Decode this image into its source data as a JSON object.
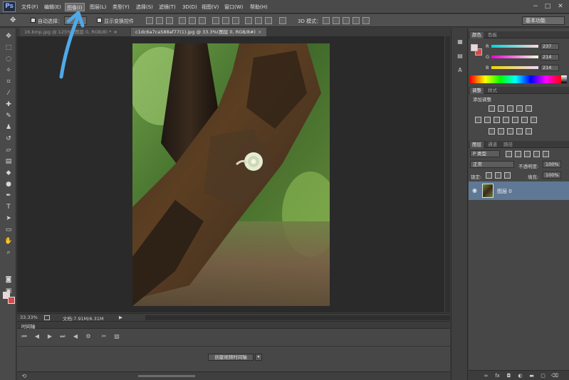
{
  "app": {
    "logo": "Ps",
    "accent_color": "#4f8fd9"
  },
  "menu": {
    "items": [
      "文件(F)",
      "编辑(E)",
      "图像(I)",
      "图层(L)",
      "类型(Y)",
      "选择(S)",
      "滤镜(T)",
      "3D(D)",
      "视图(V)",
      "窗口(W)",
      "帮助(H)"
    ],
    "active_index": 2
  },
  "window_controls": {
    "minimize": "−",
    "maximize": "□",
    "close": "✕"
  },
  "options": {
    "auto_select_label": "自动选择：",
    "transform_label": "显示变换控件",
    "mode_3d_label": "3D 模式：",
    "workspace": "基本功能"
  },
  "doc_tabs": [
    {
      "title": "16.bmp.jpg @ 125% (图层 0, RGB/8) *",
      "close": "×",
      "active": false
    },
    {
      "title": "c1dc6a7ca588af77(1).jpg @ 33.3%(图层 0, RGB/8#)",
      "close": "×",
      "active": true
    }
  ],
  "status": {
    "zoom": "33.33%",
    "doc_label": "文档:7.91M/6.31M"
  },
  "timeline": {
    "title": "时间轴",
    "create_button": "创建视频时间轴",
    "dropdown": "▾"
  },
  "panels": {
    "color": {
      "tabs": [
        "颜色",
        "色板"
      ],
      "channels": [
        {
          "label": "R",
          "value": "237"
        },
        {
          "label": "G",
          "value": "214"
        },
        {
          "label": "B",
          "value": "214"
        }
      ],
      "fg_color": "#edd6d6",
      "bg_color": "#d44a4a"
    },
    "adjustments": {
      "tabs": [
        "调整",
        "样式"
      ],
      "title": "添加调整"
    },
    "layers": {
      "tabs": [
        "图层",
        "通道",
        "路径"
      ],
      "filter_type": "P 类型",
      "blend_mode": "正常",
      "opacity_label": "不透明度:",
      "opacity": "100%",
      "lock_label": "锁定:",
      "fill_label": "填充:",
      "fill": "100%",
      "layer_name": "图层 0",
      "selected_color": "#5f7895"
    }
  }
}
